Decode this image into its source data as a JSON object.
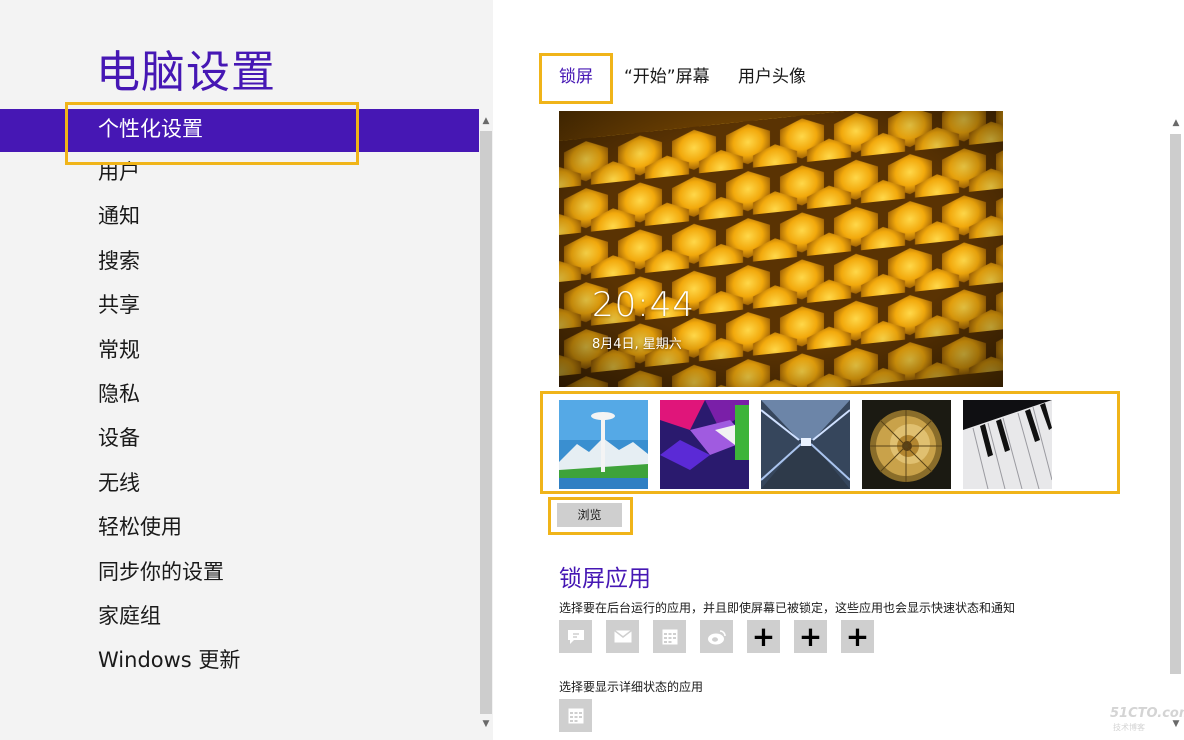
{
  "header": {
    "title": "电脑设置"
  },
  "sidebar": {
    "items": [
      {
        "label": "个性化设置",
        "selected": true
      },
      {
        "label": "用户"
      },
      {
        "label": "通知"
      },
      {
        "label": "搜索"
      },
      {
        "label": "共享"
      },
      {
        "label": "常规"
      },
      {
        "label": "隐私"
      },
      {
        "label": "设备"
      },
      {
        "label": "无线"
      },
      {
        "label": "轻松使用"
      },
      {
        "label": "同步你的设置"
      },
      {
        "label": "家庭组"
      },
      {
        "label": "Windows 更新"
      }
    ]
  },
  "tabs": [
    {
      "label": "锁屏",
      "active": true
    },
    {
      "label": "“开始”屏幕"
    },
    {
      "label": "用户头像"
    }
  ],
  "lock_screen": {
    "time": "20:44",
    "date": "8月4日, 星期六",
    "thumbnails": [
      {
        "icon": "seattle-space-needle-image"
      },
      {
        "icon": "colorful-geometric-image"
      },
      {
        "icon": "tunnel-lights-image"
      },
      {
        "icon": "nautilus-shell-image"
      },
      {
        "icon": "piano-keys-image"
      }
    ],
    "browse_label": "浏览"
  },
  "lock_apps": {
    "title": "锁屏应用",
    "description": "选择要在后台运行的应用，并且即使屏幕已被锁定，这些应用也会显示快速状态和通知",
    "apps": [
      {
        "icon": "messaging-icon"
      },
      {
        "icon": "mail-icon"
      },
      {
        "icon": "calendar-icon"
      },
      {
        "icon": "weibo-icon"
      },
      {
        "icon": "add-icon",
        "label": "+"
      },
      {
        "icon": "add-icon",
        "label": "+"
      },
      {
        "icon": "add-icon",
        "label": "+"
      }
    ],
    "detail_description": "选择要显示详细状态的应用",
    "detail_app": {
      "icon": "calendar-icon"
    }
  },
  "watermark": {
    "text": "51CTO.com",
    "sub": "技术博客"
  },
  "colors": {
    "accent": "#4617b4",
    "highlight": "#f0b419",
    "sidebar_bg": "#f3f3f3",
    "tile_bg": "#cfcfcf"
  }
}
